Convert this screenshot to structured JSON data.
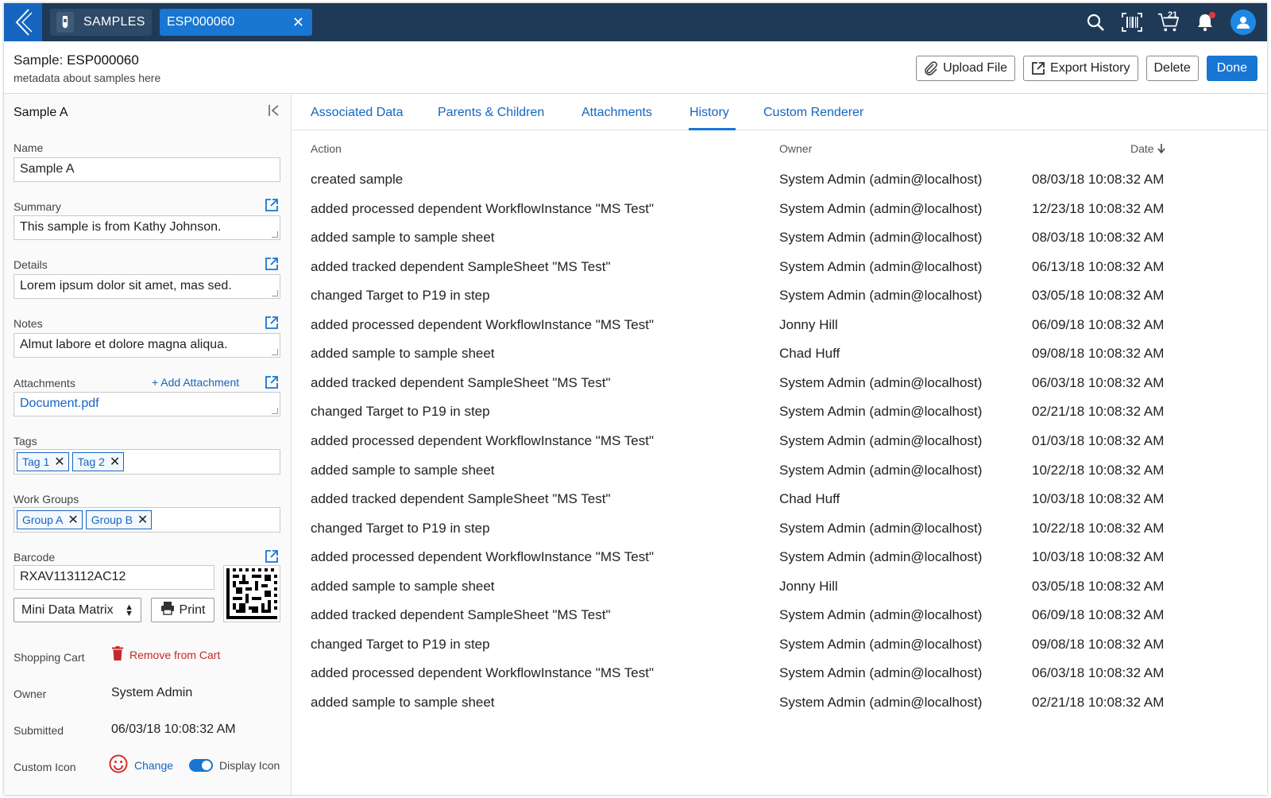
{
  "topbar": {
    "samples_tab": "SAMPLES",
    "sample_tab": "ESP000060",
    "close_glyph": "✕",
    "cart_count": "21"
  },
  "header": {
    "title_prefix": "Sample: ",
    "title_id": "ESP000060",
    "subtitle": "metadata about samples here",
    "upload_file": "Upload File",
    "export_history": "Export History",
    "delete": "Delete",
    "done": "Done"
  },
  "left": {
    "title": "Sample A",
    "name_label": "Name",
    "name_value": "Sample A",
    "summary_label": "Summary",
    "summary_value": "This sample is from Kathy Johnson.",
    "details_label": "Details",
    "details_value": "Lorem ipsum dolor sit amet, mas sed.",
    "notes_label": "Notes",
    "notes_value": "Almut labore et dolore magna aliqua.",
    "attachments_label": "Attachments",
    "add_attachment": "+ Add Attachment",
    "attachment_file": "Document.pdf",
    "tags_label": "Tags",
    "tags": [
      "Tag 1",
      "Tag 2"
    ],
    "workgroups_label": "Work Groups",
    "workgroups": [
      "Group A",
      "Group B"
    ],
    "barcode_label": "Barcode",
    "barcode_value": "RXAV113112AC12",
    "barcode_type": "Mini Data Matrix",
    "print": "Print",
    "cart_label": "Shopping Cart",
    "remove_cart": "Remove from Cart",
    "owner_label": "Owner",
    "owner_value": "System Admin",
    "submitted_label": "Submitted",
    "submitted_value": "06/03/18 10:08:32 AM",
    "custom_icon_label": "Custom Icon",
    "change": "Change",
    "display_icon": "Display Icon"
  },
  "tabs": [
    {
      "label": "Associated Data"
    },
    {
      "label": "Parents & Children"
    },
    {
      "label": "Attachments"
    },
    {
      "label": "History"
    },
    {
      "label": "Custom Renderer"
    }
  ],
  "history": {
    "col_action": "Action",
    "col_owner": "Owner",
    "col_date": "Date",
    "rows": [
      {
        "action": "created sample",
        "owner": "System Admin (admin@localhost)",
        "date": "08/03/18 10:08:32 AM"
      },
      {
        "action": "added processed dependent WorkflowInstance \"MS Test\"",
        "owner": "System Admin (admin@localhost)",
        "date": "12/23/18 10:08:32 AM"
      },
      {
        "action": "added sample to sample sheet",
        "owner": "System Admin (admin@localhost)",
        "date": "08/03/18 10:08:32 AM"
      },
      {
        "action": "added tracked dependent SampleSheet \"MS Test\"",
        "owner": "System Admin (admin@localhost)",
        "date": "06/13/18 10:08:32 AM"
      },
      {
        "action": "changed Target to P19 in step",
        "owner": "System Admin (admin@localhost)",
        "date": "03/05/18 10:08:32 AM"
      },
      {
        "action": "added processed dependent WorkflowInstance \"MS Test\"",
        "owner": "Jonny Hill",
        "date": "06/09/18 10:08:32 AM"
      },
      {
        "action": "added sample to sample sheet",
        "owner": "Chad Huff",
        "date": "09/08/18 10:08:32 AM"
      },
      {
        "action": "added tracked dependent SampleSheet \"MS Test\"",
        "owner": "System Admin (admin@localhost)",
        "date": "06/03/18 10:08:32 AM"
      },
      {
        "action": "changed Target to P19 in step",
        "owner": "System Admin (admin@localhost)",
        "date": "02/21/18 10:08:32 AM"
      },
      {
        "action": "added processed dependent WorkflowInstance \"MS Test\"",
        "owner": "System Admin (admin@localhost)",
        "date": "01/03/18 10:08:32 AM"
      },
      {
        "action": "added sample to sample sheet",
        "owner": "System Admin (admin@localhost)",
        "date": "10/22/18 10:08:32 AM"
      },
      {
        "action": "added tracked dependent SampleSheet \"MS Test\"",
        "owner": "Chad Huff",
        "date": "10/03/18 10:08:32 AM"
      },
      {
        "action": "changed Target to P19 in step",
        "owner": "System Admin (admin@localhost)",
        "date": "10/22/18 10:08:32 AM"
      },
      {
        "action": "added processed dependent WorkflowInstance \"MS Test\"",
        "owner": "System Admin (admin@localhost)",
        "date": "10/03/18 10:08:32 AM"
      },
      {
        "action": "added sample to sample sheet",
        "owner": "Jonny Hill",
        "date": "03/05/18 10:08:32 AM"
      },
      {
        "action": "added tracked dependent SampleSheet \"MS Test\"",
        "owner": "System Admin (admin@localhost)",
        "date": "06/09/18 10:08:32 AM"
      },
      {
        "action": "changed Target to P19 in step",
        "owner": "System Admin (admin@localhost)",
        "date": "09/08/18 10:08:32 AM"
      },
      {
        "action": "added processed dependent WorkflowInstance \"MS Test\"",
        "owner": "System Admin (admin@localhost)",
        "date": "06/03/18 10:08:32 AM"
      },
      {
        "action": "added sample to sample sheet",
        "owner": "System Admin (admin@localhost)",
        "date": "02/21/18 10:08:32 AM"
      }
    ]
  },
  "colors": {
    "topbar": "#1f3a57",
    "accent": "#1976d2",
    "link": "#1565c0",
    "danger": "#c62828"
  },
  "icons": {
    "back": "back-chevron-icon",
    "tube": "test-tube-icon",
    "search": "search-icon",
    "barcode": "barcode-scanner-icon",
    "cart": "cart-icon",
    "bell": "bell-icon",
    "user": "user-icon",
    "external": "external-link-icon",
    "collapse": "collapse-left-icon",
    "paperclip": "paperclip-icon",
    "trash": "trash-icon",
    "printer": "printer-icon",
    "smiley": "smiley-icon",
    "sort": "sort-down-icon"
  }
}
